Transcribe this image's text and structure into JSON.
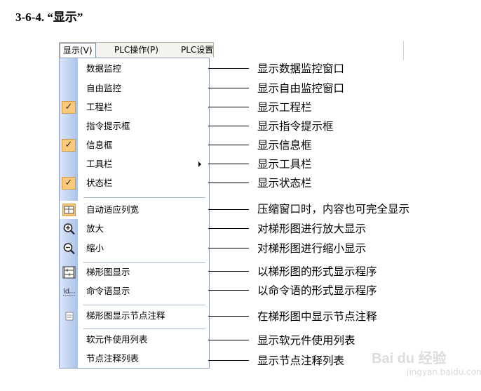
{
  "heading": "3-6-4. “显示”",
  "menubar": [
    "显示(V)",
    "PLC操作(P)",
    "PLC设置"
  ],
  "menu_items": [
    {
      "label": "数据监控",
      "checked": false,
      "icon": "",
      "submenu": false,
      "callout": "显示数据监控窗口"
    },
    {
      "label": "自由监控",
      "checked": false,
      "icon": "",
      "submenu": false,
      "callout": "显示自由监控窗口"
    },
    {
      "label": "工程栏",
      "checked": true,
      "icon": "check-icon",
      "submenu": false,
      "callout": "显示工程栏"
    },
    {
      "label": "指令提示框",
      "checked": false,
      "icon": "",
      "submenu": false,
      "callout": "显示指令提示框"
    },
    {
      "label": "信息框",
      "checked": true,
      "icon": "check-icon",
      "submenu": false,
      "callout": "显示信息框"
    },
    {
      "label": "工具栏",
      "checked": false,
      "icon": "",
      "submenu": true,
      "callout": "显示工具栏"
    },
    {
      "label": "状态栏",
      "checked": true,
      "icon": "check-icon",
      "submenu": false,
      "callout": "显示状态栏"
    },
    {
      "label": "自动适应列宽",
      "checked": false,
      "icon": "auto-fit-width-icon",
      "submenu": false,
      "callout": "压缩窗口时，内容也可完全显示"
    },
    {
      "label": "放大",
      "checked": false,
      "icon": "zoom-in-icon",
      "submenu": false,
      "callout": "对梯形图进行放大显示"
    },
    {
      "label": "缩小",
      "checked": false,
      "icon": "zoom-out-icon",
      "submenu": false,
      "callout": "对梯形图进行缩小显示"
    },
    {
      "label": "梯形图显示",
      "checked": false,
      "icon": "ladder-diagram-icon",
      "submenu": false,
      "callout": "以梯形图的形式显示程序"
    },
    {
      "label": "命令语显示",
      "checked": false,
      "icon": "instruction-list-icon",
      "submenu": false,
      "callout": "以命令语的形式显示程序"
    },
    {
      "label": "梯形图显示节点注释",
      "checked": false,
      "icon": "node-comment-icon",
      "submenu": false,
      "callout": "在梯形图中显示节点注释"
    },
    {
      "label": "软元件使用列表",
      "checked": false,
      "icon": "",
      "submenu": false,
      "callout": "显示软元件使用列表"
    },
    {
      "label": "节点注释列表",
      "checked": false,
      "icon": "",
      "submenu": false,
      "callout": "显示节点注释列表"
    }
  ],
  "watermark": "Bai du 经验",
  "watermark_sub": "jingyan.baidu.com",
  "colors": {
    "check_bg": "#fbc97a",
    "strip_left": "#dbe6f9",
    "strip_right": "#a9c2ea",
    "menu_border": "#8a9bb8"
  }
}
